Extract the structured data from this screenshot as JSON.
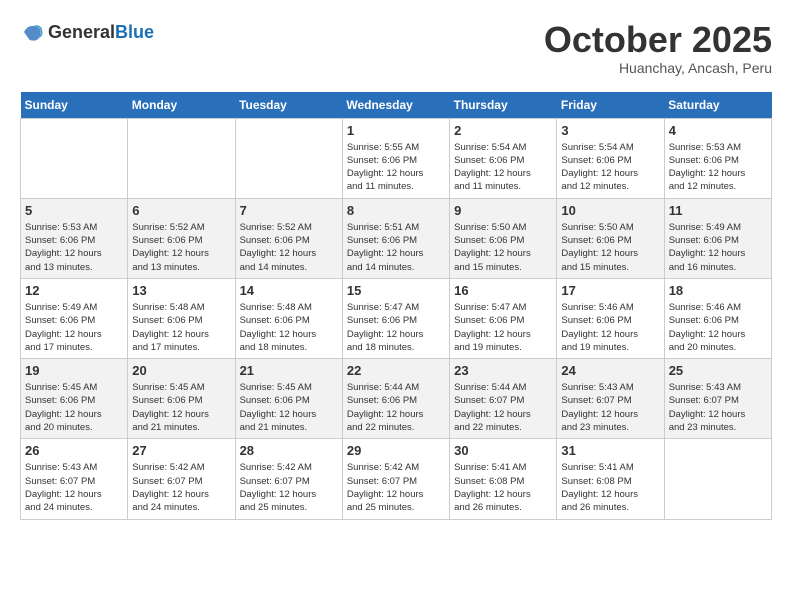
{
  "logo": {
    "general": "General",
    "blue": "Blue"
  },
  "header": {
    "title": "October 2025",
    "subtitle": "Huanchay, Ancash, Peru"
  },
  "weekdays": [
    "Sunday",
    "Monday",
    "Tuesday",
    "Wednesday",
    "Thursday",
    "Friday",
    "Saturday"
  ],
  "weeks": [
    [
      {
        "day": "",
        "detail": ""
      },
      {
        "day": "",
        "detail": ""
      },
      {
        "day": "",
        "detail": ""
      },
      {
        "day": "1",
        "detail": "Sunrise: 5:55 AM\nSunset: 6:06 PM\nDaylight: 12 hours\nand 11 minutes."
      },
      {
        "day": "2",
        "detail": "Sunrise: 5:54 AM\nSunset: 6:06 PM\nDaylight: 12 hours\nand 11 minutes."
      },
      {
        "day": "3",
        "detail": "Sunrise: 5:54 AM\nSunset: 6:06 PM\nDaylight: 12 hours\nand 12 minutes."
      },
      {
        "day": "4",
        "detail": "Sunrise: 5:53 AM\nSunset: 6:06 PM\nDaylight: 12 hours\nand 12 minutes."
      }
    ],
    [
      {
        "day": "5",
        "detail": "Sunrise: 5:53 AM\nSunset: 6:06 PM\nDaylight: 12 hours\nand 13 minutes."
      },
      {
        "day": "6",
        "detail": "Sunrise: 5:52 AM\nSunset: 6:06 PM\nDaylight: 12 hours\nand 13 minutes."
      },
      {
        "day": "7",
        "detail": "Sunrise: 5:52 AM\nSunset: 6:06 PM\nDaylight: 12 hours\nand 14 minutes."
      },
      {
        "day": "8",
        "detail": "Sunrise: 5:51 AM\nSunset: 6:06 PM\nDaylight: 12 hours\nand 14 minutes."
      },
      {
        "day": "9",
        "detail": "Sunrise: 5:50 AM\nSunset: 6:06 PM\nDaylight: 12 hours\nand 15 minutes."
      },
      {
        "day": "10",
        "detail": "Sunrise: 5:50 AM\nSunset: 6:06 PM\nDaylight: 12 hours\nand 15 minutes."
      },
      {
        "day": "11",
        "detail": "Sunrise: 5:49 AM\nSunset: 6:06 PM\nDaylight: 12 hours\nand 16 minutes."
      }
    ],
    [
      {
        "day": "12",
        "detail": "Sunrise: 5:49 AM\nSunset: 6:06 PM\nDaylight: 12 hours\nand 17 minutes."
      },
      {
        "day": "13",
        "detail": "Sunrise: 5:48 AM\nSunset: 6:06 PM\nDaylight: 12 hours\nand 17 minutes."
      },
      {
        "day": "14",
        "detail": "Sunrise: 5:48 AM\nSunset: 6:06 PM\nDaylight: 12 hours\nand 18 minutes."
      },
      {
        "day": "15",
        "detail": "Sunrise: 5:47 AM\nSunset: 6:06 PM\nDaylight: 12 hours\nand 18 minutes."
      },
      {
        "day": "16",
        "detail": "Sunrise: 5:47 AM\nSunset: 6:06 PM\nDaylight: 12 hours\nand 19 minutes."
      },
      {
        "day": "17",
        "detail": "Sunrise: 5:46 AM\nSunset: 6:06 PM\nDaylight: 12 hours\nand 19 minutes."
      },
      {
        "day": "18",
        "detail": "Sunrise: 5:46 AM\nSunset: 6:06 PM\nDaylight: 12 hours\nand 20 minutes."
      }
    ],
    [
      {
        "day": "19",
        "detail": "Sunrise: 5:45 AM\nSunset: 6:06 PM\nDaylight: 12 hours\nand 20 minutes."
      },
      {
        "day": "20",
        "detail": "Sunrise: 5:45 AM\nSunset: 6:06 PM\nDaylight: 12 hours\nand 21 minutes."
      },
      {
        "day": "21",
        "detail": "Sunrise: 5:45 AM\nSunset: 6:06 PM\nDaylight: 12 hours\nand 21 minutes."
      },
      {
        "day": "22",
        "detail": "Sunrise: 5:44 AM\nSunset: 6:06 PM\nDaylight: 12 hours\nand 22 minutes."
      },
      {
        "day": "23",
        "detail": "Sunrise: 5:44 AM\nSunset: 6:07 PM\nDaylight: 12 hours\nand 22 minutes."
      },
      {
        "day": "24",
        "detail": "Sunrise: 5:43 AM\nSunset: 6:07 PM\nDaylight: 12 hours\nand 23 minutes."
      },
      {
        "day": "25",
        "detail": "Sunrise: 5:43 AM\nSunset: 6:07 PM\nDaylight: 12 hours\nand 23 minutes."
      }
    ],
    [
      {
        "day": "26",
        "detail": "Sunrise: 5:43 AM\nSunset: 6:07 PM\nDaylight: 12 hours\nand 24 minutes."
      },
      {
        "day": "27",
        "detail": "Sunrise: 5:42 AM\nSunset: 6:07 PM\nDaylight: 12 hours\nand 24 minutes."
      },
      {
        "day": "28",
        "detail": "Sunrise: 5:42 AM\nSunset: 6:07 PM\nDaylight: 12 hours\nand 25 minutes."
      },
      {
        "day": "29",
        "detail": "Sunrise: 5:42 AM\nSunset: 6:07 PM\nDaylight: 12 hours\nand 25 minutes."
      },
      {
        "day": "30",
        "detail": "Sunrise: 5:41 AM\nSunset: 6:08 PM\nDaylight: 12 hours\nand 26 minutes."
      },
      {
        "day": "31",
        "detail": "Sunrise: 5:41 AM\nSunset: 6:08 PM\nDaylight: 12 hours\nand 26 minutes."
      },
      {
        "day": "",
        "detail": ""
      }
    ]
  ]
}
